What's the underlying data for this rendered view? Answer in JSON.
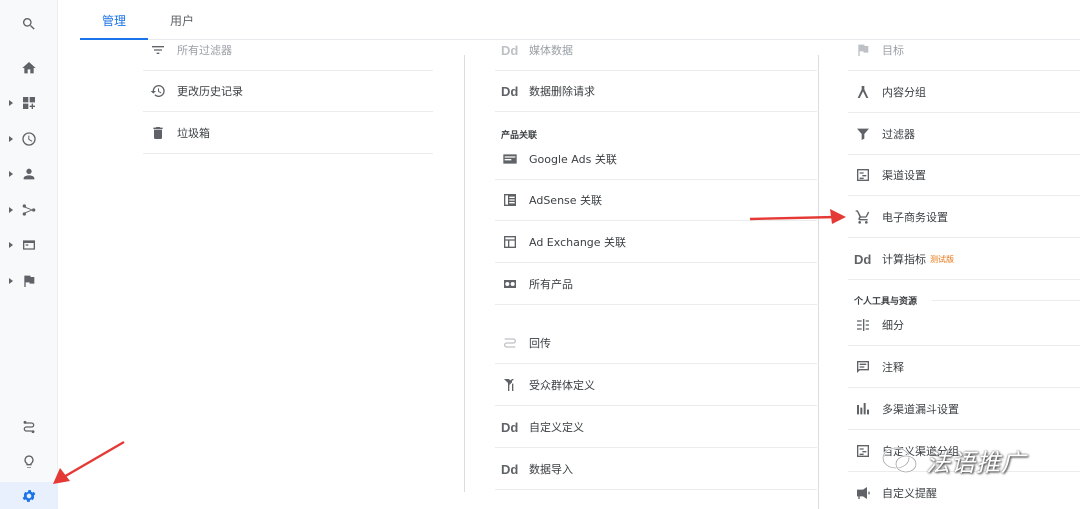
{
  "tabs": {
    "admin": "管理",
    "user": "用户"
  },
  "rail": {
    "icons": [
      "search-icon",
      "home-icon",
      "customization-icon",
      "realtime-icon",
      "audience-icon",
      "acquisition-icon",
      "behavior-icon",
      "conversions-icon",
      "attribution-icon",
      "discover-icon",
      "admin-gear-icon"
    ]
  },
  "col1": {
    "cut_label": "所有过滤器",
    "items": [
      {
        "label": "更改历史记录",
        "icon": "history-icon"
      },
      {
        "label": "垃圾箱",
        "icon": "trash-icon"
      }
    ]
  },
  "col2": {
    "cut_label": "媒体数据",
    "items_top": [
      {
        "label": "数据删除请求",
        "icon": "dd-icon",
        "mono": "Dd"
      }
    ],
    "section_products": "产品关联",
    "products": [
      {
        "label": "Google Ads 关联",
        "icon": "google-ads-icon"
      },
      {
        "label": "AdSense 关联",
        "icon": "adsense-icon"
      },
      {
        "label": "Ad Exchange 关联",
        "icon": "ad-exchange-icon"
      },
      {
        "label": "所有产品",
        "icon": "all-products-icon"
      }
    ],
    "items_bottom": [
      {
        "label": "回传",
        "icon": "postbacks-icon"
      },
      {
        "label": "受众群体定义",
        "icon": "audience-def-icon"
      },
      {
        "label": "自定义定义",
        "icon": "dd-icon",
        "mono": "Dd"
      },
      {
        "label": "数据导入",
        "icon": "dd-icon",
        "mono": "Dd"
      }
    ]
  },
  "col3": {
    "cut_label": "目标",
    "items_top": [
      {
        "label": "内容分组",
        "icon": "content-grouping-icon"
      },
      {
        "label": "过滤器",
        "icon": "filter-icon"
      },
      {
        "label": "渠道设置",
        "icon": "channel-settings-icon"
      },
      {
        "label": "电子商务设置",
        "icon": "cart-icon"
      },
      {
        "label": "计算指标",
        "icon": "dd-icon",
        "mono": "Dd",
        "badge": "测试版"
      }
    ],
    "section_personal": "个人工具与资源",
    "items_bottom": [
      {
        "label": "细分",
        "icon": "segments-icon"
      },
      {
        "label": "注释",
        "icon": "annotation-icon"
      },
      {
        "label": "多渠道漏斗设置",
        "icon": "mcf-icon"
      },
      {
        "label": "自定义渠道分组",
        "icon": "channel-grouping-icon"
      },
      {
        "label": "自定义提醒",
        "icon": "alerts-icon"
      }
    ]
  },
  "watermark": {
    "text": "法语推广"
  }
}
